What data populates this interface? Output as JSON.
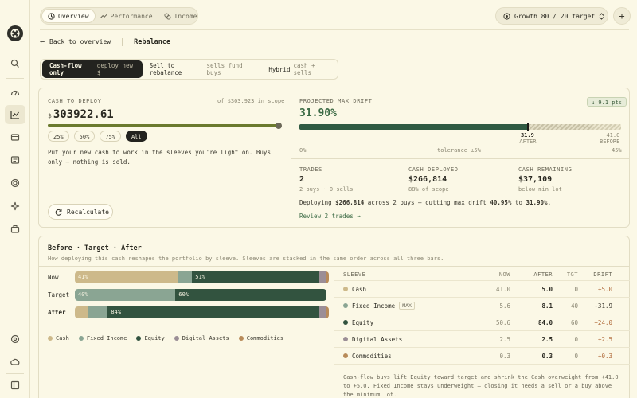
{
  "tabs": [
    {
      "label": "Overview",
      "icon": "clock-icon",
      "active": true
    },
    {
      "label": "Performance",
      "icon": "trend-icon",
      "active": false
    },
    {
      "label": "Income",
      "icon": "coins-icon",
      "active": false
    }
  ],
  "profile": {
    "label": "Growth 80 / 20 target"
  },
  "breadcrumb": {
    "back": "Back to overview",
    "title": "Rebalance"
  },
  "modes": [
    {
      "label": "Cash-flow only",
      "sub": "deploy new $",
      "active": true
    },
    {
      "label": "Sell to rebalance",
      "sub": "sells fund buys",
      "active": false
    },
    {
      "label": "Hybrid",
      "sub": "cash + sells",
      "active": false
    }
  ],
  "cash": {
    "label": "CASH TO DEPLOY",
    "scope": "of $303,923 in scope",
    "currency": "$",
    "amount": "303922.61",
    "slider_fraction": 1.0,
    "presets": [
      {
        "label": "25%",
        "active": false
      },
      {
        "label": "50%",
        "active": false
      },
      {
        "label": "75%",
        "active": false
      },
      {
        "label": "All",
        "active": true
      }
    ],
    "description": "Put your new cash to work in the sleeves you're light on. Buys only — nothing is sold.",
    "recalc_label": "Recalculate"
  },
  "drift": {
    "label": "PROJECTED MAX DRIFT",
    "value": "31.90%",
    "badge": "↓ 9.1 pts",
    "after_value": 31.9,
    "before_value": 41.0,
    "scale_max": 45,
    "after_label": "31.9",
    "after_tag": "AFTER",
    "before_label": "41.0",
    "before_tag": "BEFORE",
    "axis_min": "0%",
    "axis_mid": "tolerance ±5%",
    "axis_max": "45%"
  },
  "stats": [
    {
      "label": "TRADES",
      "value": "2",
      "sub": "2 buys · 0 sells"
    },
    {
      "label": "CASH DEPLOYED",
      "value": "$266,814",
      "sub": "88% of scope"
    },
    {
      "label": "CASH REMAINING",
      "value": "$37,109",
      "sub": "below min lot"
    }
  ],
  "summary": {
    "p1": "Deploying ",
    "b1": "$266,814",
    "p2": " across 2 buys — cutting max drift ",
    "b2": "40.95%",
    "p3": " to ",
    "b3": "31.90%",
    "p4": "."
  },
  "review_link": "Review 2 trades →",
  "bta": {
    "title": "Before · Target · After",
    "subtitle": "How deploying this cash reshapes the portfolio by sleeve. Sleeves are stacked in the same order across all three bars.",
    "rows": [
      {
        "label": "Now",
        "bold": false,
        "segments": [
          41.0,
          5.6,
          50.6,
          2.5,
          0.3
        ],
        "labels": [
          "41%",
          "",
          "51%",
          "",
          ""
        ]
      },
      {
        "label": "Target",
        "bold": false,
        "segments": [
          0,
          40,
          60,
          0,
          0
        ],
        "labels": [
          "",
          "40%",
          "60%",
          "",
          ""
        ]
      },
      {
        "label": "After",
        "bold": true,
        "segments": [
          5.0,
          8.1,
          84.0,
          2.5,
          0.3
        ],
        "labels": [
          "",
          "",
          "84%",
          "",
          ""
        ]
      }
    ],
    "legend": [
      "Cash",
      "Fixed Income",
      "Equity",
      "Digital Assets",
      "Commodities"
    ],
    "colors": [
      "#cdb98a",
      "#8aa593",
      "#32533f",
      "#9b8e96",
      "#b88b59"
    ]
  },
  "table": {
    "headers": {
      "sleeve": "SLEEVE",
      "now": "NOW",
      "after": "AFTER",
      "tgt": "TGT",
      "drift": "DRIFT"
    },
    "rows": [
      {
        "name": "Cash",
        "tag": "",
        "now": "41.0",
        "after": "5.0",
        "tgt": "0",
        "drift": "+5.0",
        "drift_color": "#b06a3a"
      },
      {
        "name": "Fixed Income",
        "tag": "MAX",
        "now": "5.6",
        "after": "8.1",
        "tgt": "40",
        "drift": "-31.9",
        "drift_color": "#3a382e"
      },
      {
        "name": "Equity",
        "tag": "",
        "now": "50.6",
        "after": "84.0",
        "tgt": "60",
        "drift": "+24.0",
        "drift_color": "#b06a3a"
      },
      {
        "name": "Digital Assets",
        "tag": "",
        "now": "2.5",
        "after": "2.5",
        "tgt": "0",
        "drift": "+2.5",
        "drift_color": "#b06a3a"
      },
      {
        "name": "Commodities",
        "tag": "",
        "now": "0.3",
        "after": "0.3",
        "tgt": "0",
        "drift": "+0.3",
        "drift_color": "#b06a3a"
      }
    ],
    "note": "Cash-flow buys lift Equity toward target and shrink the Cash overweight from +41.0 to +5.0. Fixed Income stays underweight — closing it needs a sell or a buy above the minimum lot."
  }
}
